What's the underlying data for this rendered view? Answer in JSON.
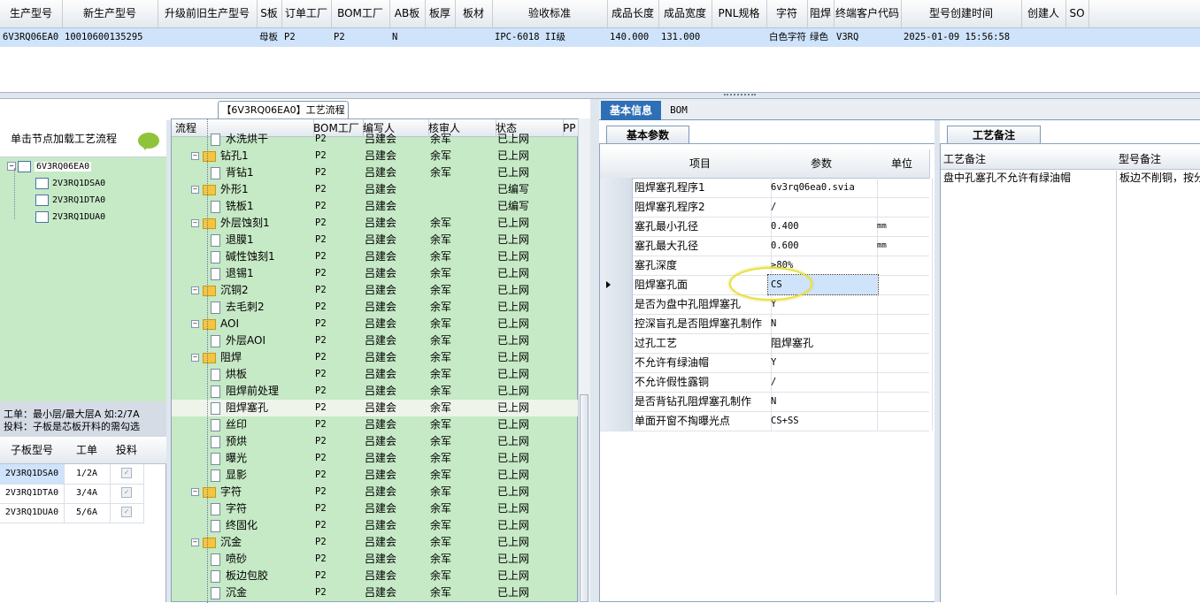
{
  "top_grid": {
    "headers": [
      "生产型号",
      "新生产型号",
      "升级前旧生产型号",
      "S板",
      "订单工厂",
      "BOM工厂",
      "AB板",
      "板厚",
      "板材",
      "验收标准",
      "成品长度",
      "成品宽度",
      "PNL规格",
      "字符",
      "阻焊",
      "终端客户代码",
      "型号创建时间",
      "创建人",
      "SO"
    ],
    "row": [
      "6V3RQ06EA0",
      "10010600135295",
      "",
      "母板",
      "P2",
      "P2",
      "N",
      "",
      "",
      "IPC-6018 II级",
      "140.000",
      "131.000",
      "",
      "白色字符",
      "绿色",
      "V3RQ",
      "2025-01-09 15:56:58",
      "",
      ""
    ]
  },
  "left_panel": {
    "load_label": "单击节点加载工艺流程",
    "tree": {
      "root": "6V3RQ06EA0",
      "children": [
        "2V3RQ1DSA0",
        "2V3RQ1DTA0",
        "2V3RQ1DUA0"
      ]
    },
    "note_line1": "工单：最小层/最大层A 如:2/7A",
    "note_line2": "投料：子板是芯板开料的需勾选",
    "subgrid": {
      "headers": [
        "子板型号",
        "工单",
        "投料"
      ],
      "rows": [
        {
          "model": "2V3RQ1DSA0",
          "order": "1/2A",
          "checked": true
        },
        {
          "model": "2V3RQ1DTA0",
          "order": "3/4A",
          "checked": true
        },
        {
          "model": "2V3RQ1DUA0",
          "order": "5/6A",
          "checked": true
        }
      ]
    }
  },
  "process": {
    "title": "【6V3RQ06EA0】工艺流程",
    "headers": [
      "流程",
      "BOM工厂",
      "编写人",
      "核审人",
      "状态",
      "PP"
    ],
    "rows": [
      {
        "name": "水洗烘干",
        "level": 2,
        "bom": "P2",
        "writer": "吕建会",
        "reviewer": "余军",
        "status": "已上网"
      },
      {
        "name": "钻孔1",
        "level": 1,
        "bom": "P2",
        "writer": "吕建会",
        "reviewer": "余军",
        "status": "已上网"
      },
      {
        "name": "背钻1",
        "level": 2,
        "bom": "P2",
        "writer": "吕建会",
        "reviewer": "余军",
        "status": "已上网"
      },
      {
        "name": "外形1",
        "level": 1,
        "bom": "P2",
        "writer": "吕建会",
        "reviewer": "",
        "status": "已编写"
      },
      {
        "name": "铣板1",
        "level": 2,
        "bom": "P2",
        "writer": "吕建会",
        "reviewer": "",
        "status": "已编写"
      },
      {
        "name": "外层蚀刻1",
        "level": 1,
        "bom": "P2",
        "writer": "吕建会",
        "reviewer": "余军",
        "status": "已上网"
      },
      {
        "name": "退膜1",
        "level": 2,
        "bom": "P2",
        "writer": "吕建会",
        "reviewer": "余军",
        "status": "已上网"
      },
      {
        "name": "碱性蚀刻1",
        "level": 2,
        "bom": "P2",
        "writer": "吕建会",
        "reviewer": "余军",
        "status": "已上网"
      },
      {
        "name": "退锡1",
        "level": 2,
        "bom": "P2",
        "writer": "吕建会",
        "reviewer": "余军",
        "status": "已上网"
      },
      {
        "name": "沉铜2",
        "level": 1,
        "bom": "P2",
        "writer": "吕建会",
        "reviewer": "余军",
        "status": "已上网"
      },
      {
        "name": "去毛刺2",
        "level": 2,
        "bom": "P2",
        "writer": "吕建会",
        "reviewer": "余军",
        "status": "已上网"
      },
      {
        "name": "AOI",
        "level": 1,
        "bom": "P2",
        "writer": "吕建会",
        "reviewer": "余军",
        "status": "已上网"
      },
      {
        "name": "外层AOI",
        "level": 2,
        "bom": "P2",
        "writer": "吕建会",
        "reviewer": "余军",
        "status": "已上网"
      },
      {
        "name": "阻焊",
        "level": 1,
        "bom": "P2",
        "writer": "吕建会",
        "reviewer": "余军",
        "status": "已上网"
      },
      {
        "name": "烘板",
        "level": 2,
        "bom": "P2",
        "writer": "吕建会",
        "reviewer": "余军",
        "status": "已上网"
      },
      {
        "name": "阻焊前处理",
        "level": 2,
        "bom": "P2",
        "writer": "吕建会",
        "reviewer": "余军",
        "status": "已上网"
      },
      {
        "name": "阻焊塞孔",
        "level": 2,
        "bom": "P2",
        "writer": "吕建会",
        "reviewer": "余军",
        "status": "已上网",
        "selected": true
      },
      {
        "name": "丝印",
        "level": 2,
        "bom": "P2",
        "writer": "吕建会",
        "reviewer": "余军",
        "status": "已上网"
      },
      {
        "name": "预烘",
        "level": 2,
        "bom": "P2",
        "writer": "吕建会",
        "reviewer": "余军",
        "status": "已上网"
      },
      {
        "name": "曝光",
        "level": 2,
        "bom": "P2",
        "writer": "吕建会",
        "reviewer": "余军",
        "status": "已上网"
      },
      {
        "name": "显影",
        "level": 2,
        "bom": "P2",
        "writer": "吕建会",
        "reviewer": "余军",
        "status": "已上网"
      },
      {
        "name": "字符",
        "level": 1,
        "bom": "P2",
        "writer": "吕建会",
        "reviewer": "余军",
        "status": "已上网"
      },
      {
        "name": "字符",
        "level": 2,
        "bom": "P2",
        "writer": "吕建会",
        "reviewer": "余军",
        "status": "已上网"
      },
      {
        "name": "终固化",
        "level": 2,
        "bom": "P2",
        "writer": "吕建会",
        "reviewer": "余军",
        "status": "已上网"
      },
      {
        "name": "沉金",
        "level": 1,
        "bom": "P2",
        "writer": "吕建会",
        "reviewer": "余军",
        "status": "已上网"
      },
      {
        "name": "喷砂",
        "level": 2,
        "bom": "P2",
        "writer": "吕建会",
        "reviewer": "余军",
        "status": "已上网"
      },
      {
        "name": "板边包胶",
        "level": 2,
        "bom": "P2",
        "writer": "吕建会",
        "reviewer": "余军",
        "status": "已上网"
      },
      {
        "name": "沉金",
        "level": 2,
        "bom": "P2",
        "writer": "吕建会",
        "reviewer": "余军",
        "status": "已上网"
      }
    ]
  },
  "right_panel": {
    "tabs": [
      "基本信息",
      "BOM"
    ],
    "subtab": "基本参数",
    "param_headers": [
      "项目",
      "参数",
      "单位"
    ],
    "params": [
      {
        "item": "阻焊塞孔程序1",
        "value": "6v3rq06ea0.svia",
        "unit": ""
      },
      {
        "item": "阻焊塞孔程序2",
        "value": "/",
        "unit": ""
      },
      {
        "item": "塞孔最小孔径",
        "value": "0.400",
        "unit": "mm"
      },
      {
        "item": "塞孔最大孔径",
        "value": "0.600",
        "unit": "mm"
      },
      {
        "item": "塞孔深度",
        "value": "≥80%",
        "unit": ""
      },
      {
        "item": "阻焊塞孔面",
        "value": "CS",
        "unit": "",
        "current": true
      },
      {
        "item": "是否为盘中孔阻焊塞孔",
        "value": "Y",
        "unit": ""
      },
      {
        "item": "控深盲孔是否阻焊塞孔制作",
        "value": "N",
        "unit": ""
      },
      {
        "item": "过孔工艺",
        "value": "阻焊塞孔",
        "unit": ""
      },
      {
        "item": "不允许有绿油帽",
        "value": "Y",
        "unit": ""
      },
      {
        "item": "不允许假性露铜",
        "value": "/",
        "unit": ""
      },
      {
        "item": "是否背钻孔阻焊塞孔制作",
        "value": "N",
        "unit": ""
      },
      {
        "item": "单面开窗不掏曝光点",
        "value": "CS+SS",
        "unit": ""
      }
    ],
    "remark_tab": "工艺备注",
    "remark_headers": [
      "工艺备注",
      "型号备注"
    ],
    "remark_text": "盘中孔塞孔不允许有绿油帽",
    "model_remark_text": "板边不削铜，按分"
  },
  "colors": {
    "accent": "#2f6fb6",
    "tree_bg": "#c6e9c6",
    "selected_row": "#cfe3fb",
    "highlight": "#e8e23a"
  }
}
